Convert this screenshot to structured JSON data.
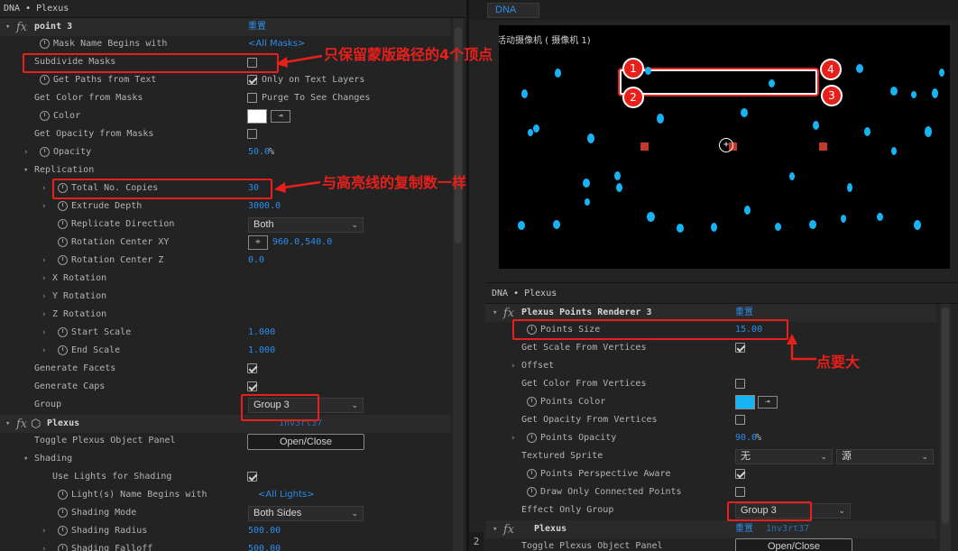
{
  "left_panel": {
    "title": "DNA • Plexus",
    "effect_name": "point 3",
    "reset": "重置",
    "rows": {
      "mask_name": {
        "label": "Mask Name Begins with",
        "value": "<All Masks>"
      },
      "subdivide": {
        "label": "Subdivide Masks"
      },
      "paths_text": {
        "label": "Get Paths from Text",
        "check_label": "Only on Text Layers"
      },
      "color_masks": {
        "label": "Get Color from Masks",
        "check_label": "Purge To See Changes"
      },
      "color": {
        "label": "Color"
      },
      "opacity_masks": {
        "label": "Get Opacity from Masks"
      },
      "opacity": {
        "label": "Opacity",
        "value": "50.0",
        "unit": "%"
      },
      "replication": {
        "label": "Replication"
      },
      "copies": {
        "label": "Total No. Copies",
        "value": "30"
      },
      "extrude": {
        "label": "Extrude Depth",
        "value": "3000.0"
      },
      "rep_dir": {
        "label": "Replicate Direction",
        "value": "Both"
      },
      "rot_center_xy": {
        "label": "Rotation Center XY",
        "value": "960.0,540.0"
      },
      "rot_center_z": {
        "label": "Rotation Center Z",
        "value": "0.0"
      },
      "x_rot": {
        "label": "X Rotation"
      },
      "y_rot": {
        "label": "Y Rotation"
      },
      "z_rot": {
        "label": "Z Rotation"
      },
      "start_scale": {
        "label": "Start Scale",
        "value": "1.000"
      },
      "end_scale": {
        "label": "End Scale",
        "value": "1.000"
      },
      "facets": {
        "label": "Generate Facets"
      },
      "caps": {
        "label": "Generate Caps"
      },
      "group": {
        "label": "Group",
        "value": "Group 3"
      },
      "plexus_label": "Plexus",
      "plexus_id": "1nv3rt37",
      "toggle": {
        "label": "Toggle Plexus Object Panel",
        "button": "Open/Close"
      },
      "shading": {
        "label": "Shading"
      },
      "use_lights": {
        "label": "Use Lights for Shading"
      },
      "light_name": {
        "label": "Light(s) Name Begins with",
        "value": "<All Lights>"
      },
      "shading_mode": {
        "label": "Shading Mode",
        "value": "Both Sides"
      },
      "shading_radius": {
        "label": "Shading Radius",
        "value": "500.00"
      },
      "shading_falloff": {
        "label": "Shading Falloff",
        "value": "500.00"
      }
    }
  },
  "viewer": {
    "tab": "DNA",
    "camera_label": "活动摄像机 ( 摄像机 1)",
    "badges": [
      "1",
      "2",
      "3",
      "4"
    ],
    "bottom_mark": "2"
  },
  "right_panel": {
    "title": "DNA • Plexus",
    "effect_name": "Plexus Points Renderer 3",
    "reset": "重置",
    "rows": {
      "points_size": {
        "label": "Points Size",
        "value": "15.00"
      },
      "scale_vertices": {
        "label": "Get Scale From Vertices"
      },
      "offset": {
        "label": "Offset"
      },
      "color_vertices": {
        "label": "Get Color From Vertices"
      },
      "points_color": {
        "label": "Points Color"
      },
      "opacity_vertices": {
        "label": "Get Opacity From Vertices"
      },
      "points_opacity": {
        "label": "Points Opacity",
        "value": "90.0",
        "unit": "%"
      },
      "textured_sprite": {
        "label": "Textured Sprite",
        "value1": "无",
        "value2": "源"
      },
      "perspective": {
        "label": "Points Perspective Aware"
      },
      "connected": {
        "label": "Draw Only Connected Points"
      },
      "effect_group": {
        "label": "Effect Only Group",
        "value": "Group 3"
      },
      "plexus_label": "Plexus",
      "plexus_id": "1nv3rt37",
      "toggle": {
        "label": "Toggle Plexus Object Panel",
        "button": "Open/Close"
      }
    }
  },
  "annotations": {
    "a1": "只保留蒙版路径的4个顶点",
    "a2": "与高亮线的复制数一样",
    "a3": "点要大"
  },
  "colors": {
    "accent": "#2d8ceb",
    "highlight": "#e8201c",
    "point": "#16b4f5",
    "panel": "#232323"
  }
}
